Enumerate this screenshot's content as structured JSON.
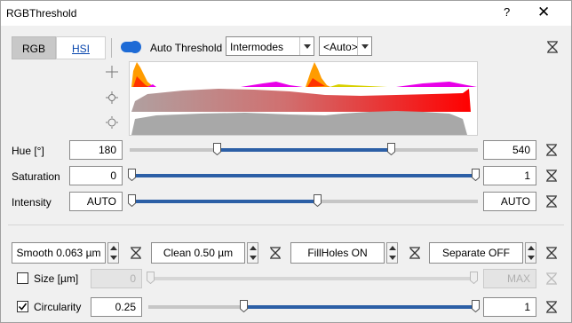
{
  "window": {
    "title": "RGBThreshold",
    "help_glyph": "?",
    "close_glyph": "✕"
  },
  "mode_tabs": [
    {
      "label": "RGB",
      "selected": true
    },
    {
      "label": "HSI",
      "selected": false
    }
  ],
  "auto_threshold": {
    "label": "Auto Threshold",
    "enabled": true,
    "method": "Intermodes",
    "target": "<Auto>"
  },
  "histogram": {
    "colors": {
      "red": "#ff0000",
      "orange": "#ff9c00",
      "magenta": "#e800e8",
      "gray": "#a8a8a8"
    }
  },
  "sliders": [
    {
      "label": "Hue [°]",
      "low": "180",
      "high": "540",
      "low_frac": 0.25,
      "high_frac": 0.75
    },
    {
      "label": "Saturation",
      "low": "0",
      "high": "1",
      "low_frac": 0.0,
      "high_frac": 1.0
    },
    {
      "label": "Intensity",
      "low": "AUTO",
      "high": "AUTO",
      "low_frac": 0.0,
      "high_frac": 0.54
    }
  ],
  "operations": [
    {
      "label": "Smooth 0.063 µm"
    },
    {
      "label": "Clean 0.50 µm"
    },
    {
      "label": "FillHoles ON"
    },
    {
      "label": "Separate OFF"
    }
  ],
  "filters": {
    "size": {
      "label": "Size [µm]",
      "checked": false,
      "low": "0",
      "high": "MAX"
    },
    "circularity": {
      "label": "Circularity",
      "checked": true,
      "low": "0.25",
      "high": "1",
      "low_frac": 0.29,
      "high_frac": 1.0
    }
  },
  "colors": {
    "accent": "#1e6bd6",
    "slider_fill": "#2c5fa6"
  }
}
